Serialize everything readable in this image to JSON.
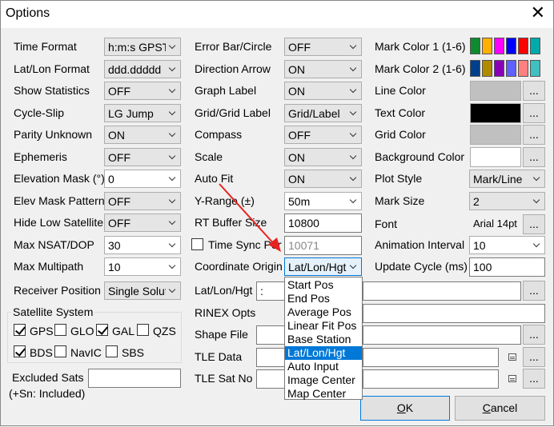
{
  "window": {
    "title": "Options"
  },
  "col1": {
    "time_format": {
      "label": "Time Format",
      "value": "h:m:s GPST"
    },
    "latlon_format": {
      "label": "Lat/Lon Format",
      "value": "ddd.ddddd"
    },
    "show_statistics": {
      "label": "Show Statistics",
      "value": "OFF"
    },
    "cycle_slip": {
      "label": "Cycle-Slip",
      "value": "LG Jump"
    },
    "parity_unknown": {
      "label": "Parity Unknown",
      "value": "ON"
    },
    "ephemeris": {
      "label": "Ephemeris",
      "value": "OFF"
    },
    "elevation_mask": {
      "label": "Elevation Mask (°)",
      "value": "0"
    },
    "elev_mask_pattern": {
      "label": "Elev Mask Pattern",
      "value": "OFF"
    },
    "hide_low_satellite": {
      "label": "Hide Low Satellite",
      "value": "OFF"
    },
    "max_nsat_dop": {
      "label": "Max NSAT/DOP",
      "value": "30"
    },
    "max_multipath": {
      "label": "Max Multipath",
      "value": "10"
    },
    "receiver_position": {
      "label": "Receiver Position",
      "value": "Single Solution"
    }
  },
  "satellite_system": {
    "label": "Satellite System",
    "gps": "GPS",
    "glo": "GLO",
    "gal": "GAL",
    "qzs": "QZS",
    "bds": "BDS",
    "navic": "NavIC",
    "sbs": "SBS"
  },
  "excluded": {
    "label1": "Excluded Sats",
    "label2": "(+Sn: Included)",
    "value": ""
  },
  "col2": {
    "error_bar": {
      "label": "Error Bar/Circle",
      "value": "OFF"
    },
    "direction_arrow": {
      "label": "Direction Arrow",
      "value": "ON"
    },
    "graph_label": {
      "label": "Graph Label",
      "value": "ON"
    },
    "grid_label": {
      "label": "Grid/Grid Label",
      "value": "Grid/Label"
    },
    "compass": {
      "label": "Compass",
      "value": "OFF"
    },
    "scale": {
      "label": "Scale",
      "value": "ON"
    },
    "auto_fit": {
      "label": "Auto Fit",
      "value": "ON"
    },
    "y_range": {
      "label": "Y-Range (±)",
      "value": "50m"
    },
    "rt_buffer": {
      "label": "RT Buffer Size",
      "value": "10800"
    },
    "time_sync": {
      "label": "Time Sync Port",
      "value": "10071"
    },
    "coord_origin": {
      "label": "Coordinate Origin",
      "value": "Lat/Lon/Hgt"
    },
    "latlonhgt": {
      "label": "Lat/Lon/Hgt",
      "value": ":"
    },
    "rinex_opts": {
      "label": "RINEX Opts",
      "value": ""
    },
    "shape_file": {
      "label": "Shape File",
      "value": ""
    },
    "tle_data": {
      "label": "TLE Data",
      "value": ""
    },
    "tle_sat_no": {
      "label": "TLE Sat No",
      "value": ""
    }
  },
  "coord_dropdown": {
    "items": [
      "Start Pos",
      "End Pos",
      "Average Pos",
      "Linear Fit Pos",
      "Base Station",
      "Lat/Lon/Hgt",
      "Auto Input",
      "Image Center",
      "Map Center"
    ],
    "selected_index": 5
  },
  "col3": {
    "mark_color1": {
      "label": "Mark Color 1 (1-6)",
      "colors": [
        "#0f8a2f",
        "#ffb000",
        "#ff00ff",
        "#0000ff",
        "#ff0000",
        "#00aaaa"
      ]
    },
    "mark_color2": {
      "label": "Mark Color 2 (1-6)",
      "colors": [
        "#003f8a",
        "#b08a00",
        "#8a00b8",
        "#6060ff",
        "#ff8080",
        "#40c0c0"
      ]
    },
    "line_color": {
      "label": "Line Color",
      "color": "#c0c0c0"
    },
    "text_color": {
      "label": "Text Color",
      "color": "#000000"
    },
    "grid_color": {
      "label": "Grid Color",
      "color": "#c0c0c0"
    },
    "background_color": {
      "label": "Background Color",
      "color": "#ffffff"
    },
    "plot_style": {
      "label": "Plot Style",
      "value": "Mark/Line"
    },
    "mark_size": {
      "label": "Mark Size",
      "value": "2"
    },
    "font": {
      "label": "Font",
      "value": "Arial 14pt"
    },
    "animation_interval": {
      "label": "Animation Interval",
      "value": "10"
    },
    "update_cycle": {
      "label": "Update Cycle (ms)",
      "value": "100"
    }
  },
  "buttons": {
    "ellipsis": "...",
    "ok_u": "O",
    "ok_rest": "K",
    "cancel_u": "C",
    "cancel_rest": "ancel"
  },
  "annotation": {
    "arrow_color": "#e8231f"
  }
}
